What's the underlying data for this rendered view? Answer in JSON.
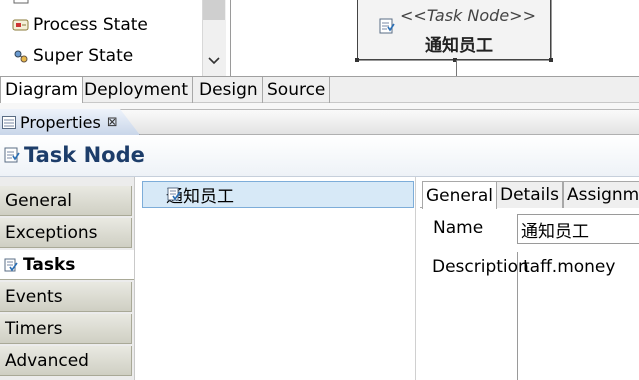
{
  "palette": {
    "items": [
      {
        "label": "Process State",
        "icon": "process-state-icon"
      },
      {
        "label": "Super State",
        "icon": "super-state-icon"
      }
    ]
  },
  "canvas": {
    "node": {
      "stereotype": "<<Task Node>>",
      "name": "通知员工",
      "icon": "task-node-icon"
    }
  },
  "editor_tabs": [
    "Diagram",
    "Deployment",
    "Design",
    "Source"
  ],
  "properties": {
    "view_title": "Properties",
    "title": "Task Node",
    "categories": [
      "General",
      "Exceptions",
      "Tasks",
      "Events",
      "Timers",
      "Advanced"
    ],
    "active_category": "Tasks",
    "tasks": [
      "通知员工"
    ],
    "detail_tabs": [
      "General",
      "Details",
      "Assignm"
    ],
    "fields": {
      "name_label": "Name",
      "name_value": "通知员工",
      "description_label": "Description",
      "description_value": "taff.money"
    }
  },
  "colors": {
    "title": "#1d3d6a",
    "selection": "#d7e9f7"
  }
}
